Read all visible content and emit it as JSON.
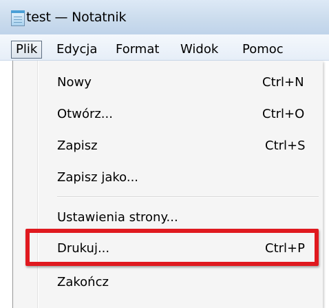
{
  "window": {
    "title": "test — Notatnik",
    "icon": "notepad-icon"
  },
  "menubar": {
    "items": [
      {
        "label": "Plik",
        "open": true
      },
      {
        "label": "Edycja"
      },
      {
        "label": "Format"
      },
      {
        "label": "Widok"
      },
      {
        "label": "Pomoc"
      }
    ]
  },
  "file_menu": {
    "items": [
      {
        "label": "Nowy",
        "shortcut": "Ctrl+N"
      },
      {
        "label": "Otwórz...",
        "shortcut": "Ctrl+O"
      },
      {
        "label": "Zapisz",
        "shortcut": "Ctrl+S"
      },
      {
        "label": "Zapisz jako...",
        "shortcut": ""
      },
      {
        "label": "Ustawienia strony...",
        "shortcut": ""
      },
      {
        "label": "Drukuj...",
        "shortcut": "Ctrl+P",
        "highlighted": true
      },
      {
        "label": "Zakończ",
        "shortcut": ""
      }
    ]
  },
  "colors": {
    "highlight": "#e0191f"
  }
}
